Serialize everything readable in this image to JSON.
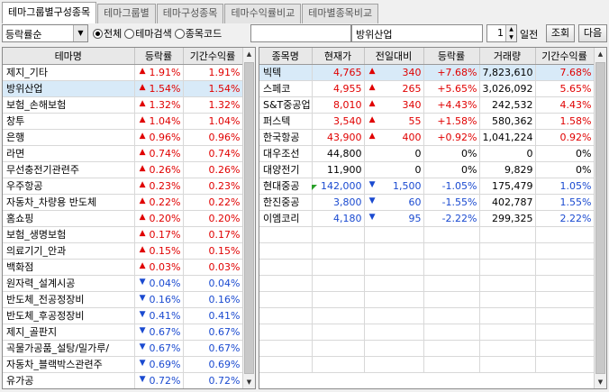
{
  "tabs": [
    "테마그룹별구성종목",
    "테마그룹별",
    "테마구성종목",
    "테마수익률비교",
    "테마별종목비교"
  ],
  "toolbar": {
    "sort_select": "등락률순",
    "radio_all": "전체",
    "radio_theme_search": "테마검색",
    "radio_stock_code": "종목코드",
    "code_value": "",
    "theme_name": "방위산업",
    "period_value": "1",
    "period_unit": "일전",
    "query_button": "조회",
    "next_button": "다음"
  },
  "left_table": {
    "headers": [
      "테마명",
      "등락률",
      "기간수익률"
    ],
    "rows": [
      {
        "name": "제지_기타",
        "dir": "up",
        "rate": "1.91%",
        "period": "1.91%"
      },
      {
        "name": "방위산업",
        "dir": "up",
        "rate": "1.54%",
        "period": "1.54%"
      },
      {
        "name": "보험_손해보험",
        "dir": "up",
        "rate": "1.32%",
        "period": "1.32%"
      },
      {
        "name": "창투",
        "dir": "up",
        "rate": "1.04%",
        "period": "1.04%"
      },
      {
        "name": "은행",
        "dir": "up",
        "rate": "0.96%",
        "period": "0.96%"
      },
      {
        "name": "라면",
        "dir": "up",
        "rate": "0.74%",
        "period": "0.74%"
      },
      {
        "name": "무선충전기관련주",
        "dir": "up",
        "rate": "0.26%",
        "period": "0.26%"
      },
      {
        "name": "우주항공",
        "dir": "up",
        "rate": "0.23%",
        "period": "0.23%"
      },
      {
        "name": "자동차_차량용 반도체",
        "dir": "up",
        "rate": "0.22%",
        "period": "0.22%"
      },
      {
        "name": "홈쇼핑",
        "dir": "up",
        "rate": "0.20%",
        "period": "0.20%"
      },
      {
        "name": "보험_생명보험",
        "dir": "up",
        "rate": "0.17%",
        "period": "0.17%"
      },
      {
        "name": "의료기기_안과",
        "dir": "up",
        "rate": "0.15%",
        "period": "0.15%"
      },
      {
        "name": "백화점",
        "dir": "up",
        "rate": "0.03%",
        "period": "0.03%"
      },
      {
        "name": "원자력_설계시공",
        "dir": "down",
        "rate": "0.04%",
        "period": "0.04%"
      },
      {
        "name": "반도체_전공정장비",
        "dir": "down",
        "rate": "0.16%",
        "period": "0.16%"
      },
      {
        "name": "반도체_후공정장비",
        "dir": "down",
        "rate": "0.41%",
        "period": "0.41%"
      },
      {
        "name": "제지_골판지",
        "dir": "down",
        "rate": "0.67%",
        "period": "0.67%"
      },
      {
        "name": "곡물가공품_설탕/밀가루/",
        "dir": "down",
        "rate": "0.67%",
        "period": "0.67%"
      },
      {
        "name": "자동차_블랙박스관련주",
        "dir": "down",
        "rate": "0.69%",
        "period": "0.69%"
      },
      {
        "name": "유가공",
        "dir": "down",
        "rate": "0.72%",
        "period": "0.72%"
      }
    ]
  },
  "right_table": {
    "headers": [
      "종목명",
      "현재가",
      "전일대비",
      "등락률",
      "거래량",
      "기간수익률"
    ],
    "rows": [
      {
        "name": "빅텍",
        "price": "4,765",
        "dir": "up",
        "change": "340",
        "rate": "+7.68%",
        "volume": "7,823,610",
        "period": "7.68%"
      },
      {
        "name": "스페코",
        "price": "4,955",
        "dir": "up",
        "change": "265",
        "rate": "+5.65%",
        "volume": "3,026,092",
        "period": "5.65%"
      },
      {
        "name": "S&T중공업",
        "price": "8,010",
        "dir": "up",
        "change": "340",
        "rate": "+4.43%",
        "volume": "242,532",
        "period": "4.43%"
      },
      {
        "name": "퍼스텍",
        "price": "3,540",
        "dir": "up",
        "change": "55",
        "rate": "+1.58%",
        "volume": "580,362",
        "period": "1.58%"
      },
      {
        "name": "한국항공",
        "price": "43,900",
        "dir": "up",
        "change": "400",
        "rate": "+0.92%",
        "volume": "1,041,224",
        "period": "0.92%"
      },
      {
        "name": "대우조선",
        "price": "44,800",
        "dir": "flat",
        "change": "0",
        "rate": "0%",
        "volume": "0",
        "period": "0%"
      },
      {
        "name": "대양전기",
        "price": "11,900",
        "dir": "flat",
        "change": "0",
        "rate": "0%",
        "volume": "9,829",
        "period": "0%"
      },
      {
        "name": "현대중공",
        "price": "142,000",
        "dir": "down",
        "change": "1,500",
        "rate": "-1.05%",
        "volume": "175,479",
        "period": "1.05%"
      },
      {
        "name": "한진중공",
        "price": "3,800",
        "dir": "down",
        "change": "60",
        "rate": "-1.55%",
        "volume": "402,787",
        "period": "1.55%"
      },
      {
        "name": "이엠코리",
        "price": "4,180",
        "dir": "down",
        "change": "95",
        "rate": "-2.22%",
        "volume": "299,325",
        "period": "2.22%"
      }
    ],
    "empty_rows": 9
  },
  "colors": {
    "up": "#e00000",
    "down": "#1a4ad0",
    "selected_row": "#d8eaf8"
  }
}
